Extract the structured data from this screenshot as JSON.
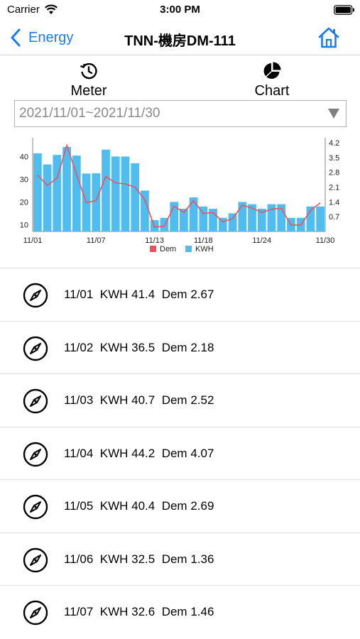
{
  "status_bar": {
    "carrier": "Carrier",
    "time": "3:00 PM"
  },
  "nav": {
    "back_label": "Energy",
    "title": "TNN-機房DM-111"
  },
  "tabs": {
    "meter": "Meter",
    "chart": "Chart"
  },
  "date_range": "2021/11/01~2021/11/30",
  "chart_data": {
    "type": "bar",
    "categories": [
      "11/01",
      "11/02",
      "11/03",
      "11/04",
      "11/05",
      "11/06",
      "11/07",
      "11/08",
      "11/09",
      "11/10",
      "11/11",
      "11/12",
      "11/13",
      "11/14",
      "11/15",
      "11/16",
      "11/17",
      "11/18",
      "11/19",
      "11/20",
      "11/21",
      "11/22",
      "11/23",
      "11/24",
      "11/25",
      "11/26",
      "11/27",
      "11/28",
      "11/29",
      "11/30"
    ],
    "x_tick_labels": [
      "11/01",
      "11/07",
      "11/13",
      "11/18",
      "11/24",
      "11/30"
    ],
    "series": [
      {
        "name": "KWH",
        "type": "bar",
        "axis": "left",
        "color": "#4fbdf0",
        "values": [
          41.4,
          36.5,
          40.7,
          44.2,
          40.4,
          32.5,
          32.6,
          43.0,
          40.0,
          40.0,
          37.0,
          25.0,
          12.0,
          13.0,
          20.0,
          17.0,
          22.0,
          18.0,
          17.0,
          13.0,
          15.0,
          20.0,
          19.0,
          17.0,
          19.0,
          19.0,
          13.0,
          13.0,
          18.0,
          18.0
        ]
      },
      {
        "name": "Dem",
        "type": "line",
        "axis": "right",
        "color": "#f0505a",
        "values": [
          2.67,
          2.18,
          2.52,
          4.07,
          2.69,
          1.36,
          1.46,
          2.6,
          2.3,
          2.25,
          2.1,
          1.5,
          0.2,
          0.25,
          1.2,
          0.9,
          1.45,
          0.85,
          0.9,
          0.45,
          0.6,
          1.25,
          1.1,
          0.9,
          1.05,
          1.1,
          0.3,
          0.3,
          1.0,
          1.35
        ]
      }
    ],
    "y_left": {
      "ticks": [
        "10",
        "20",
        "30",
        "40"
      ],
      "ylim": [
        7,
        47
      ]
    },
    "y_right": {
      "ticks": [
        "0.7",
        "1.4",
        "2.1",
        "2.8",
        "3.5",
        "4.2"
      ],
      "ylim": [
        0,
        4.3
      ]
    },
    "legend": {
      "position": "bottom",
      "items": [
        "Dem",
        "KWH"
      ]
    },
    "grid": false
  },
  "records": [
    {
      "date": "11/01",
      "kwh_label": "KWH",
      "kwh": "41.4",
      "dem_label": "Dem",
      "dem": "2.67"
    },
    {
      "date": "11/02",
      "kwh_label": "KWH",
      "kwh": "36.5",
      "dem_label": "Dem",
      "dem": "2.18"
    },
    {
      "date": "11/03",
      "kwh_label": "KWH",
      "kwh": "40.7",
      "dem_label": "Dem",
      "dem": "2.52"
    },
    {
      "date": "11/04",
      "kwh_label": "KWH",
      "kwh": "44.2",
      "dem_label": "Dem",
      "dem": "4.07"
    },
    {
      "date": "11/05",
      "kwh_label": "KWH",
      "kwh": "40.4",
      "dem_label": "Dem",
      "dem": "2.69"
    },
    {
      "date": "11/06",
      "kwh_label": "KWH",
      "kwh": "32.5",
      "dem_label": "Dem",
      "dem": "1.36"
    },
    {
      "date": "11/07",
      "kwh_label": "KWH",
      "kwh": "32.6",
      "dem_label": "Dem",
      "dem": "1.46"
    }
  ],
  "icons": {
    "wifi": "wifi-icon",
    "battery": "battery-icon",
    "back": "chevron-left-icon",
    "home": "home-icon",
    "meter": "history-icon",
    "chart": "pie-chart-icon",
    "dropdown": "triangle-down-icon",
    "record": "compass-icon"
  },
  "colors": {
    "accent": "#1a7cf0",
    "bar": "#4fbdf0",
    "line": "#f0505a"
  }
}
